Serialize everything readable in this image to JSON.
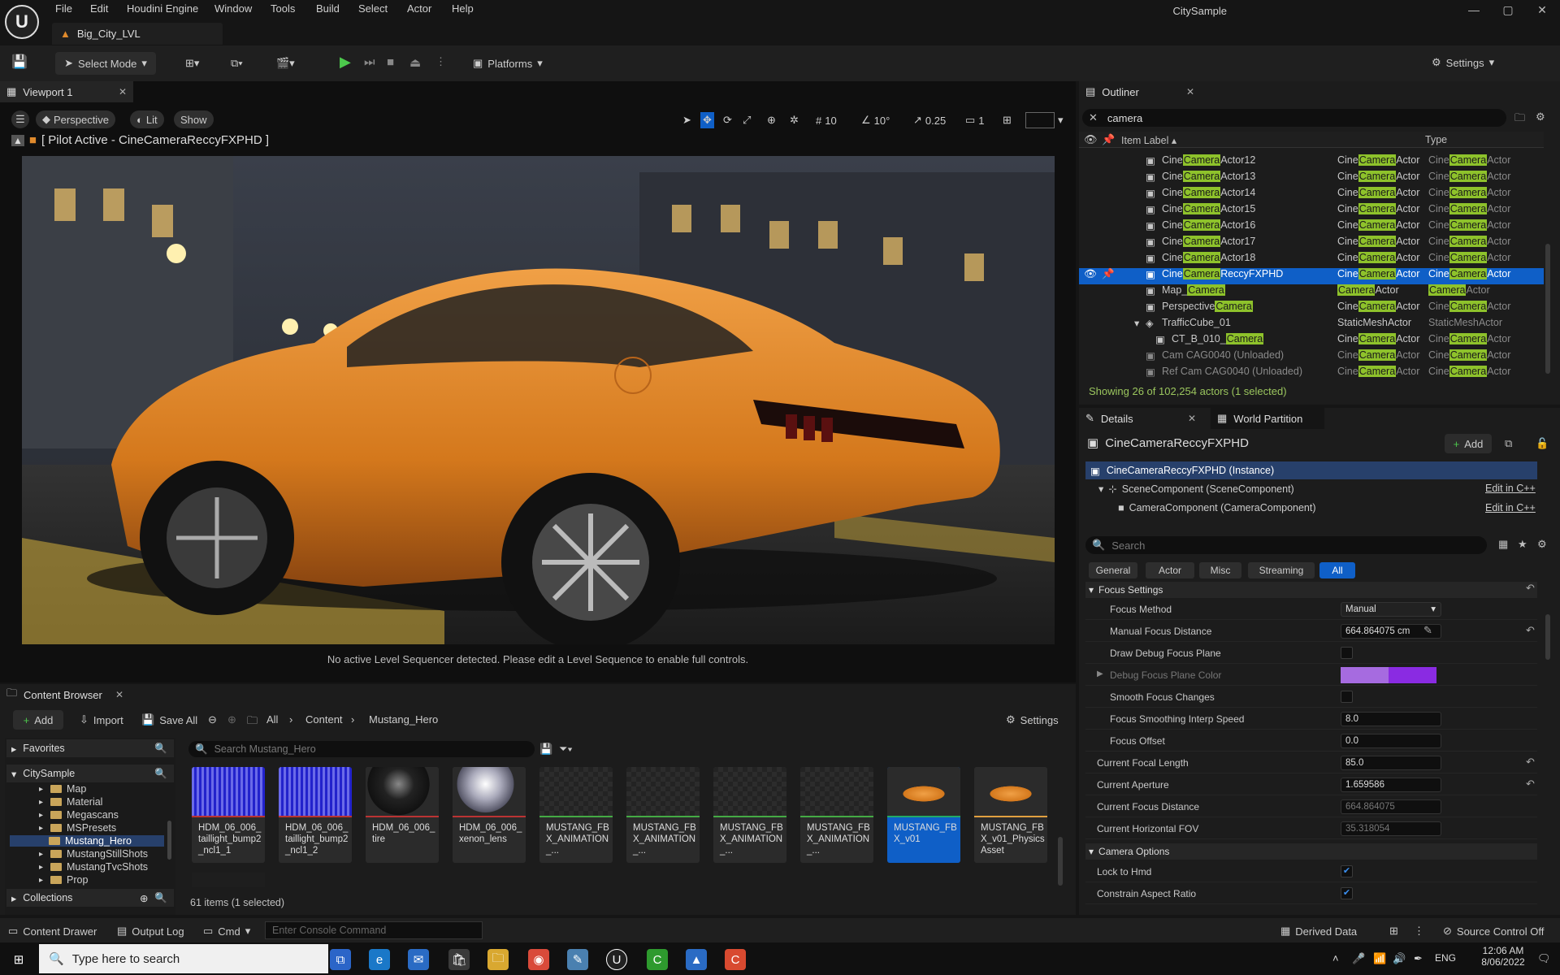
{
  "app": {
    "title": "CitySample",
    "level_tab": "Big_City_LVL"
  },
  "menu": [
    "File",
    "Edit",
    "Houdini Engine",
    "Window",
    "Tools",
    "Build",
    "Select",
    "Actor",
    "Help"
  ],
  "toolbar": {
    "select_mode": "Select Mode",
    "platforms": "Platforms",
    "settings": "Settings"
  },
  "viewport": {
    "tab": "Viewport 1",
    "perspective": "Perspective",
    "lit": "Lit",
    "show": "Show",
    "pilot": "[ Pilot Active - CineCameraReccyFXPHD ]",
    "grid": "10",
    "angle": "10°",
    "scale": "0.25",
    "camspeed": "1",
    "message": "No active Level Sequencer detected. Please edit a Level Sequence to enable full controls."
  },
  "outliner": {
    "tab": "Outliner",
    "search": "camera",
    "col_label": "Item Label",
    "col_type": "Type",
    "status": "Showing 26 of 102,254 actors (1 selected)",
    "rows": [
      {
        "pre": "Cine",
        "hl": "Camera",
        "post": "Actor12",
        "t1a": "Cine",
        "t1b": "Camera",
        "t1c": "Actor",
        "t2a": "Cine",
        "t2b": "Camera",
        "t2c": "Actor"
      },
      {
        "pre": "Cine",
        "hl": "Camera",
        "post": "Actor13",
        "t1a": "Cine",
        "t1b": "Camera",
        "t1c": "Actor",
        "t2a": "Cine",
        "t2b": "Camera",
        "t2c": "Actor"
      },
      {
        "pre": "Cine",
        "hl": "Camera",
        "post": "Actor14",
        "t1a": "Cine",
        "t1b": "Camera",
        "t1c": "Actor",
        "t2a": "Cine",
        "t2b": "Camera",
        "t2c": "Actor"
      },
      {
        "pre": "Cine",
        "hl": "Camera",
        "post": "Actor15",
        "t1a": "Cine",
        "t1b": "Camera",
        "t1c": "Actor",
        "t2a": "Cine",
        "t2b": "Camera",
        "t2c": "Actor"
      },
      {
        "pre": "Cine",
        "hl": "Camera",
        "post": "Actor16",
        "t1a": "Cine",
        "t1b": "Camera",
        "t1c": "Actor",
        "t2a": "Cine",
        "t2b": "Camera",
        "t2c": "Actor"
      },
      {
        "pre": "Cine",
        "hl": "Camera",
        "post": "Actor17",
        "t1a": "Cine",
        "t1b": "Camera",
        "t1c": "Actor",
        "t2a": "Cine",
        "t2b": "Camera",
        "t2c": "Actor"
      },
      {
        "pre": "Cine",
        "hl": "Camera",
        "post": "Actor18",
        "t1a": "Cine",
        "t1b": "Camera",
        "t1c": "Actor",
        "t2a": "Cine",
        "t2b": "Camera",
        "t2c": "Actor"
      },
      {
        "pre": "Cine",
        "hl": "Camera",
        "post": "ReccyFXPHD",
        "t1a": "Cine",
        "t1b": "Camera",
        "t1c": "Actor",
        "t2a": "Cine",
        "t2b": "Camera",
        "t2c": "Actor"
      },
      {
        "pre": "Map_",
        "hl": "Camera",
        "post": "",
        "t1a": "",
        "t1b": "Camera",
        "t1c": "Actor",
        "t2a": "",
        "t2b": "Camera",
        "t2c": "Actor"
      },
      {
        "pre": "Perspective",
        "hl": "Camera",
        "post": "",
        "t1a": "Cine",
        "t1b": "Camera",
        "t1c": "Actor",
        "t2a": "Cine",
        "t2b": "Camera",
        "t2c": "Actor"
      },
      {
        "pre": "TrafficCube_01",
        "hl": "",
        "post": "",
        "t1a": "StaticMeshActor",
        "t1b": "",
        "t1c": "",
        "t2a": "StaticMeshActor",
        "t2b": "",
        "t2c": ""
      },
      {
        "pre": "CT_B_010_",
        "hl": "Camera",
        "post": "",
        "t1a": "Cine",
        "t1b": "Camera",
        "t1c": "Actor",
        "t2a": "Cine",
        "t2b": "Camera",
        "t2c": "Actor"
      },
      {
        "pre": "Cam CAG0040 (Unloaded)",
        "hl": "",
        "post": "",
        "t1a": "Cine",
        "t1b": "Camera",
        "t1c": "Actor",
        "t2a": "Cine",
        "t2b": "Camera",
        "t2c": "Actor"
      },
      {
        "pre": "Ref Cam CAG0040 (Unloaded)",
        "hl": "",
        "post": "",
        "t1a": "Cine",
        "t1b": "Camera",
        "t1c": "Actor",
        "t2a": "Cine",
        "t2b": "Camera",
        "t2c": "Actor"
      }
    ]
  },
  "details": {
    "tab": "Details",
    "tab2": "World Partition",
    "actor": "CineCameraReccyFXPHD",
    "add": "Add",
    "instance": "CineCameraReccyFXPHD (Instance)",
    "scene": "SceneComponent (SceneComponent)",
    "camera": "CameraComponent (CameraComponent)",
    "edit_cpp": "Edit in C++",
    "search": "Search",
    "filters": [
      "General",
      "Actor",
      "Misc",
      "Streaming",
      "All"
    ],
    "focus_settings": "Focus Settings",
    "camera_options": "Camera Options",
    "props": [
      {
        "label": "Focus Method",
        "value": "Manual"
      },
      {
        "label": "Manual Focus Distance",
        "value": "664.864075 cm"
      },
      {
        "label": "Draw Debug Focus Plane",
        "value": ""
      },
      {
        "label": "Debug Focus Plane Color",
        "value": ""
      },
      {
        "label": "Smooth Focus Changes",
        "value": ""
      },
      {
        "label": "Focus Smoothing Interp Speed",
        "value": "8.0"
      },
      {
        "label": "Focus Offset",
        "value": "0.0"
      },
      {
        "label": "Current Focal Length",
        "value": "85.0"
      },
      {
        "label": "Current Aperture",
        "value": "1.659586"
      },
      {
        "label": "Current Focus Distance",
        "value": "664.864075"
      },
      {
        "label": "Current Horizontal FOV",
        "value": "35.318054"
      },
      {
        "label": "Lock to Hmd",
        "value": ""
      },
      {
        "label": "Constrain Aspect Ratio",
        "value": ""
      }
    ]
  },
  "content": {
    "tab": "Content Browser",
    "add": "Add",
    "import": "Import",
    "save_all": "Save All",
    "crumbs": [
      "All",
      "Content",
      "Mustang_Hero"
    ],
    "settings": "Settings",
    "favorites": "Favorites",
    "project": "CitySample",
    "collections": "Collections",
    "search": "Search Mustang_Hero",
    "count": "61 items (1 selected)",
    "folders": [
      "Map",
      "Material",
      "Megascans",
      "MSPresets",
      "Mustang_Hero",
      "MustangStillShots",
      "MustangTvcShots",
      "Prop"
    ],
    "assets": [
      "HDM_06_006_taillight_bump2_ncl1_1",
      "HDM_06_006_taillight_bump2_ncl1_2",
      "HDM_06_006_tire",
      "HDM_06_006_xenon_lens",
      "MUSTANG_FBX_ANIMATION_...",
      "MUSTANG_FBX_ANIMATION_...",
      "MUSTANG_FBX_ANIMATION_...",
      "MUSTANG_FBX_ANIMATION_...",
      "MUSTANG_FBX_v01",
      "MUSTANG_FBX_v01_PhysicsAsset"
    ]
  },
  "status": {
    "content_drawer": "Content Drawer",
    "output_log": "Output Log",
    "cmd": "Cmd",
    "console": "Enter Console Command",
    "derived": "Derived Data",
    "source": "Source Control Off"
  },
  "taskbar": {
    "search": "Type here to search",
    "lang": "ENG",
    "time": "12:06 AM",
    "date": "8/06/2022"
  }
}
